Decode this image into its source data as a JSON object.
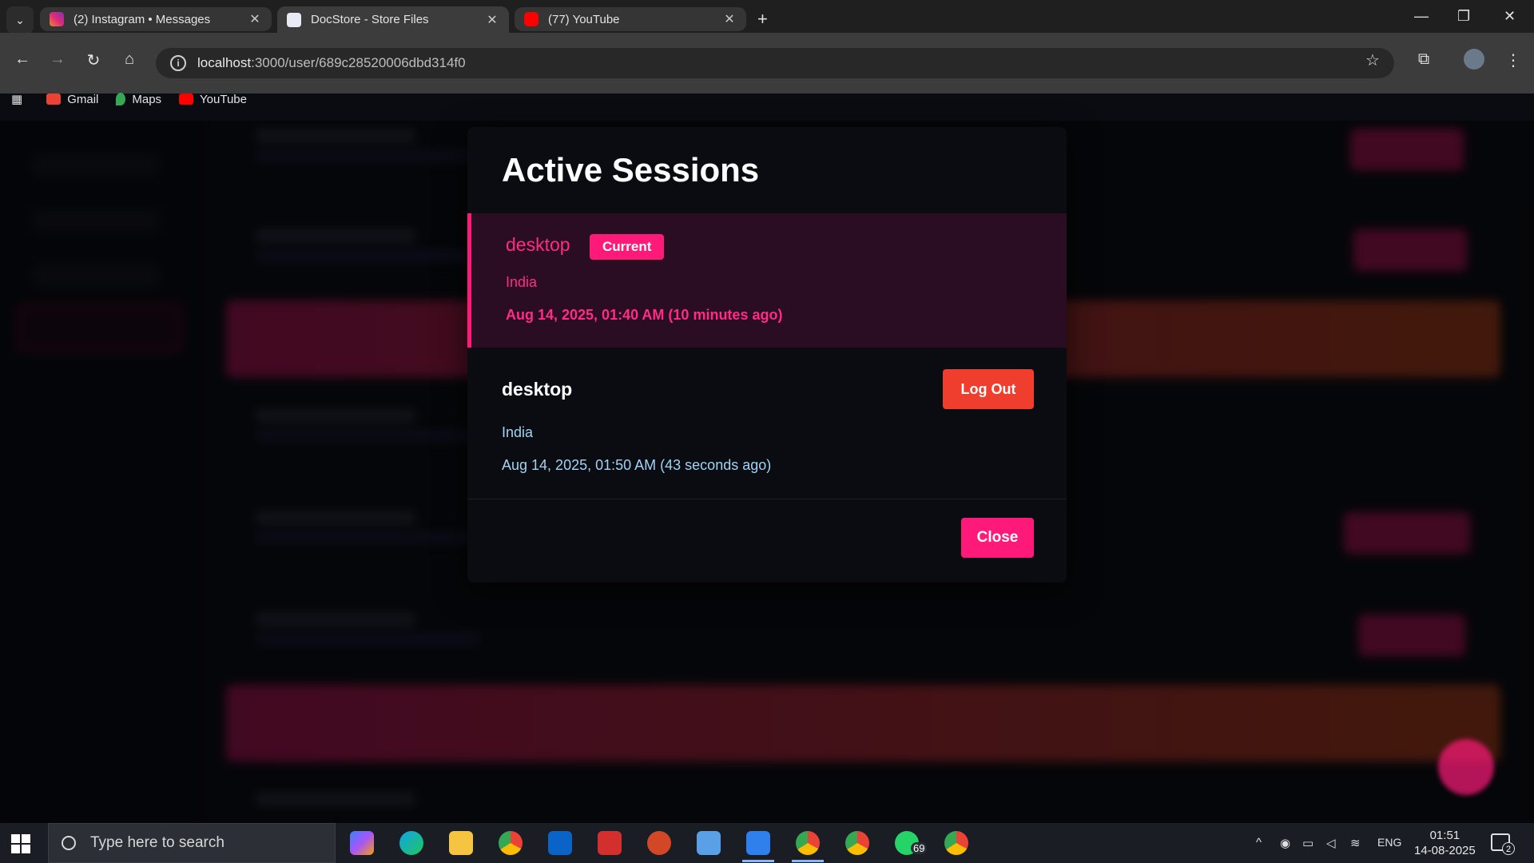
{
  "browser": {
    "tabs": [
      {
        "title": "(2) Instagram • Messages",
        "color": "#e1306c"
      },
      {
        "title": "DocStore - Store Files",
        "color": "#8ab4f8"
      },
      {
        "title": "(77) YouTube",
        "color": "#ff0000"
      }
    ],
    "url_host": "localhost",
    "url_rest": ":3000/user/689c28520006dbd314f0",
    "bookmarks": [
      {
        "label": "Gmail",
        "color": "#ea4335"
      },
      {
        "label": "Maps",
        "color": "#34a853"
      },
      {
        "label": "YouTube",
        "color": "#ff0000"
      }
    ]
  },
  "modal": {
    "title": "Active Sessions",
    "current_session": {
      "device": "desktop",
      "badge": "Current",
      "location": "India",
      "time": "Aug 14, 2025, 01:40 AM (10 minutes ago)"
    },
    "other_session": {
      "device": "desktop",
      "logout_label": "Log Out",
      "location": "India",
      "time": "Aug 14, 2025, 01:50 AM (43 seconds ago)"
    },
    "close_label": "Close"
  },
  "colors": {
    "accent": "#ff1a7a",
    "danger": "#ef3e2e",
    "info": "#9fd4f2"
  },
  "taskbar": {
    "search_placeholder": "Type here to search",
    "whatsapp_badge": "69",
    "language": "ENG",
    "time": "01:51",
    "date": "14-08-2025",
    "notifications": "2"
  }
}
